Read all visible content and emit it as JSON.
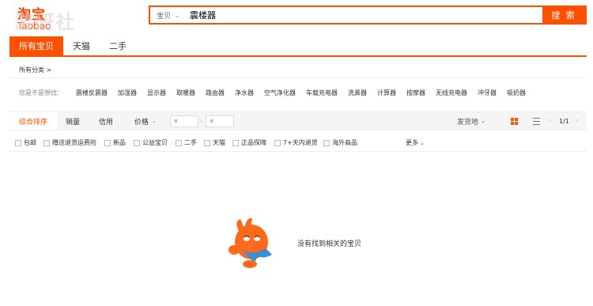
{
  "logo": {
    "cn": "淘宝",
    "en": "Taobao",
    "watermark": "游研社"
  },
  "search": {
    "scope": "宝贝",
    "query": "震楼器",
    "button": "搜 索"
  },
  "tabs": [
    "所有宝贝",
    "天猫",
    "二手"
  ],
  "all_categories": "所有分类 >",
  "suggest": {
    "label": "您是不是想找：",
    "items": [
      "震楼反震器",
      "加湿器",
      "显示器",
      "取暖器",
      "路由器",
      "净水器",
      "空气净化器",
      "车载充电器",
      "洗鼻器",
      "计算器",
      "按摩器",
      "无线充电器",
      "冲牙器",
      "吸奶器"
    ]
  },
  "toolbar": {
    "sort_default": "综合排序",
    "sort_sales": "销量",
    "sort_credit": "信用",
    "sort_price": "价格",
    "price_from": "¥",
    "price_to": "¥",
    "price_dash": "-",
    "ship_from": "发货地",
    "page": "1/1"
  },
  "filters": [
    "包邮",
    "赠送退货运费险",
    "新品",
    "公益宝贝",
    "二手",
    "天猫",
    "正品保障",
    "7+天内退货",
    "海外商品"
  ],
  "more": "更多",
  "empty_message": "没有找到相关的宝贝",
  "colors": {
    "accent": "#ff5000"
  }
}
